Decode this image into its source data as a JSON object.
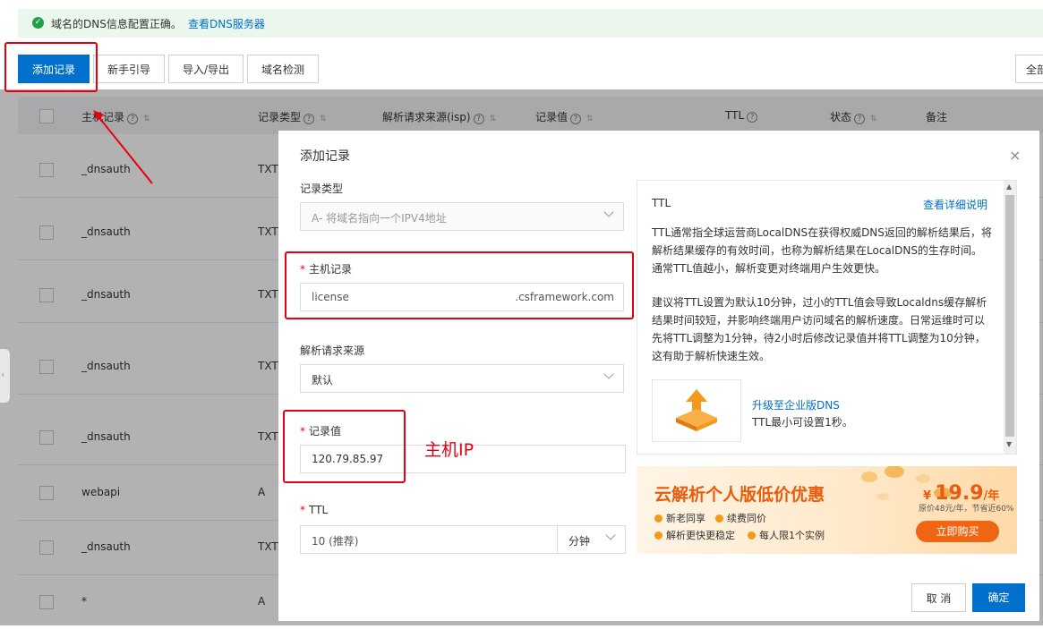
{
  "notice": {
    "text": "域名的DNS信息配置正确。",
    "link": "查看DNS服务器"
  },
  "toolbar": {
    "add": "添加记录",
    "guide": "新手引导",
    "import": "导入/导出",
    "check": "域名检测",
    "right": "全部"
  },
  "table": {
    "headers": {
      "host": "主机记录",
      "type": "记录类型",
      "isp": "解析请求来源(isp)",
      "value": "记录值",
      "ttl": "TTL",
      "status": "状态",
      "remark": "备注"
    },
    "rows": [
      {
        "host": "_dnsauth",
        "type": "TXT"
      },
      {
        "host": "_dnsauth",
        "type": "TXT"
      },
      {
        "host": "_dnsauth",
        "type": "TXT"
      },
      {
        "host": "_dnsauth",
        "type": "TXT"
      },
      {
        "host": "_dnsauth",
        "type": "TXT"
      },
      {
        "host": "webapi",
        "type": "A"
      },
      {
        "host": "_dnsauth",
        "type": "TXT"
      },
      {
        "host": "*",
        "type": "A"
      }
    ]
  },
  "modal": {
    "title": "添加记录",
    "close": "×",
    "record_type_label": "记录类型",
    "record_type_value": "A- 将域名指向一个IPV4地址",
    "host_label": "主机记录",
    "host_value": "license",
    "host_suffix": ".csframework.com",
    "isp_label": "解析请求来源",
    "isp_value": "默认",
    "value_label": "记录值",
    "value_value": "120.79.85.97",
    "ttl_label": "TTL",
    "ttl_value": "10 (推荐)",
    "ttl_unit": "分钟",
    "annotation": "主机IP",
    "cancel": "取 消",
    "ok": "确定"
  },
  "help": {
    "title": "TTL",
    "link": "查看详细说明",
    "p1": "TTL通常指全球运营商LocalDNS在获得权威DNS返回的解析结果后，将解析结果缓存的有效时间，也称为解析结果在LocalDNS的生存时间。通常TTL值越小，解析变更对终端用户生效更快。",
    "p2": "建议将TTL设置为默认10分钟，过小的TTL值会导致Localdns缓存解析结果时间较短，并影响终端用户访问域名的解析速度。日常运维时可以先将TTL调整为1分钟，待2小时后修改记录值并将TTL调整为10分钟，这有助于解析快速生效。",
    "upgrade_link": "升级至企业版DNS",
    "upgrade_desc": "TTL最小可设置1秒。"
  },
  "promo": {
    "title": "云解析个人版低价优惠",
    "items": [
      "新老同享",
      "续费同价",
      "解析更快更稳定",
      "每人限1个实例"
    ],
    "currency": "¥",
    "price": "19.9",
    "unit": "/年",
    "original": "原价48元/年，节省近60%",
    "buy": "立即购买"
  },
  "colors": {
    "primary": "#0070cc",
    "annotation_red": "#e60012",
    "promo_orange": "#f06511"
  }
}
